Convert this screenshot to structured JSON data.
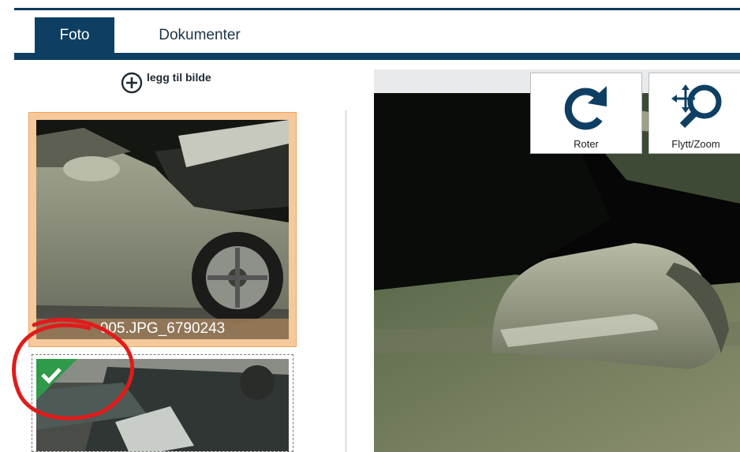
{
  "tabs": [
    {
      "label": "Foto",
      "active": true
    },
    {
      "label": "Dokumenter",
      "active": false
    }
  ],
  "add_photo": {
    "label": "legg til bilde",
    "icon": "plus-circle-icon"
  },
  "thumbnails": [
    {
      "caption": "005.JPG_6790243",
      "selected": true
    },
    {
      "caption": "",
      "selected": false,
      "checked": true
    }
  ],
  "toolbar": {
    "rotate": {
      "label": "Roter",
      "icon": "rotate-icon"
    },
    "move_zoom": {
      "label": "Flytt/Zoom",
      "icon": "move-zoom-icon"
    }
  },
  "colors": {
    "tab_active": "#0e3f62",
    "accent_icon": "#0e3f62",
    "selected_border": "#f6c99a",
    "check_badge": "#2e9a4a",
    "annotation": "#e01b1b"
  }
}
